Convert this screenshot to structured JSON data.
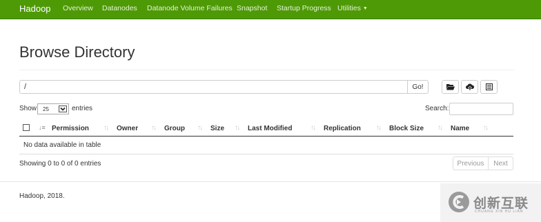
{
  "navbar": {
    "brand": "Hadoop",
    "items": [
      {
        "label": "Overview"
      },
      {
        "label": "Datanodes"
      },
      {
        "label": "Datanode Volume Failures"
      },
      {
        "label": "Snapshot"
      },
      {
        "label": "Startup Progress"
      },
      {
        "label": "Utilities"
      }
    ],
    "color": "#4e9a06"
  },
  "page": {
    "title": "Browse Directory"
  },
  "path_bar": {
    "value": "/",
    "go_label": "Go!",
    "icons": [
      "folder-open-icon",
      "upload-icon",
      "list-icon"
    ]
  },
  "table_controls": {
    "show_label": "Show",
    "page_size": "25",
    "entries_label": "entries",
    "search_label": "Search:",
    "search_value": ""
  },
  "table": {
    "columns": [
      "Permission",
      "Owner",
      "Group",
      "Size",
      "Last Modified",
      "Replication",
      "Block Size",
      "Name"
    ],
    "empty_message": "No data available in table",
    "info": "Showing 0 to 0 of 0 entries"
  },
  "pagination": {
    "previous": "Previous",
    "next": "Next"
  },
  "footer": {
    "text": "Hadoop, 2018."
  },
  "watermark": {
    "text": "创新互联",
    "subtext": "CHUANG XIN HU LIAN"
  }
}
